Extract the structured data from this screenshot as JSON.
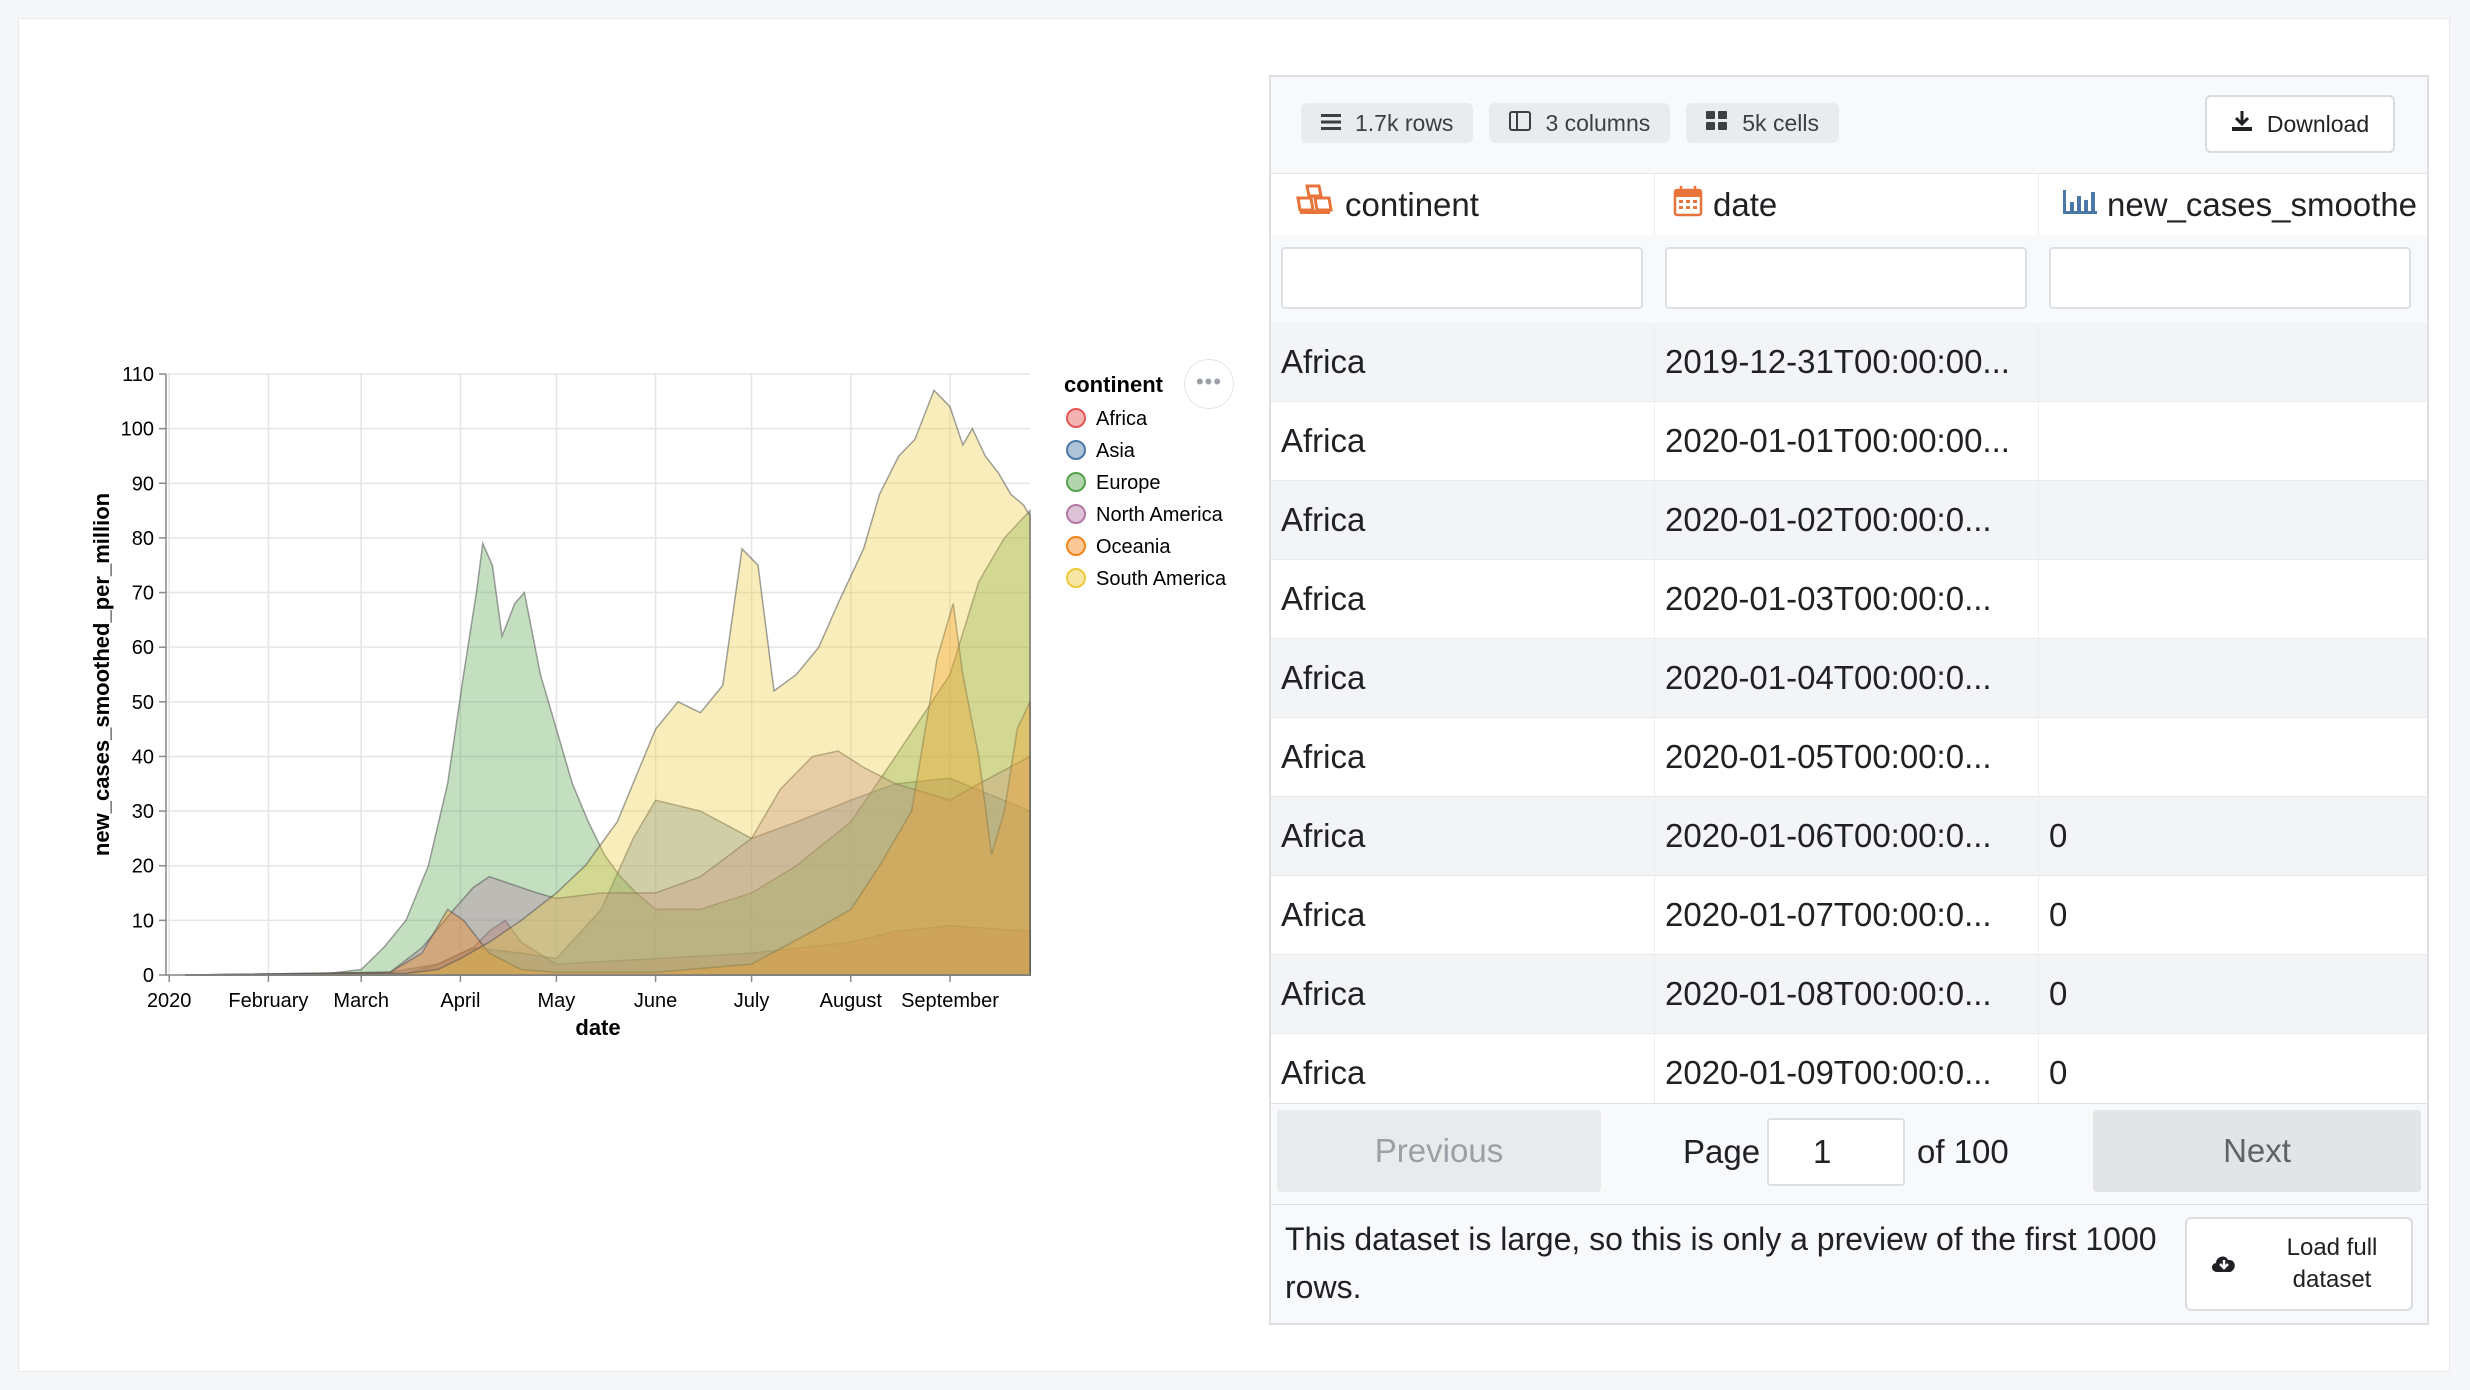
{
  "chart_data": {
    "type": "area",
    "xlabel": "date",
    "ylabel": "new_cases_smoothed_per_million",
    "ylim": [
      0,
      110
    ],
    "yticks": [
      0,
      10,
      20,
      30,
      40,
      50,
      60,
      70,
      80,
      90,
      100,
      110
    ],
    "xticks": [
      "2020",
      "February",
      "March",
      "April",
      "May",
      "June",
      "July",
      "August",
      "September"
    ],
    "xtick_dates": [
      "2020-01-01",
      "2020-02-01",
      "2020-03-01",
      "2020-04-01",
      "2020-05-01",
      "2020-06-01",
      "2020-07-01",
      "2020-08-01",
      "2020-09-01"
    ],
    "xlim": [
      "2019-12-31",
      "2020-09-26"
    ],
    "grid": true,
    "stacked": false,
    "legend_title": "continent",
    "legend_position": "right",
    "series": [
      {
        "name": "Africa",
        "color": "#e45756",
        "points": [
          [
            "2020-01-06",
            0
          ],
          [
            "2020-03-15",
            0.3
          ],
          [
            "2020-03-25",
            2
          ],
          [
            "2020-04-05",
            5
          ],
          [
            "2020-04-10",
            8
          ],
          [
            "2020-04-15",
            10
          ],
          [
            "2020-04-20",
            6
          ],
          [
            "2020-05-01",
            2
          ],
          [
            "2020-06-01",
            3
          ],
          [
            "2020-07-01",
            4
          ],
          [
            "2020-08-01",
            6
          ],
          [
            "2020-08-15",
            8
          ],
          [
            "2020-09-01",
            9
          ],
          [
            "2020-09-26",
            8
          ]
        ]
      },
      {
        "name": "Asia",
        "color": "#4c78a8",
        "points": [
          [
            "2020-01-06",
            0
          ],
          [
            "2020-02-15",
            0.2
          ],
          [
            "2020-03-10",
            0.5
          ],
          [
            "2020-03-25",
            2
          ],
          [
            "2020-04-05",
            5
          ],
          [
            "2020-04-20",
            4
          ],
          [
            "2020-05-01",
            3
          ],
          [
            "2020-05-15",
            12
          ],
          [
            "2020-05-25",
            25
          ],
          [
            "2020-06-01",
            32
          ],
          [
            "2020-06-15",
            30
          ],
          [
            "2020-07-01",
            25
          ],
          [
            "2020-07-15",
            28
          ],
          [
            "2020-08-01",
            32
          ],
          [
            "2020-08-15",
            35
          ],
          [
            "2020-09-01",
            36
          ],
          [
            "2020-09-26",
            30
          ]
        ]
      },
      {
        "name": "Europe",
        "color": "#54a24b",
        "points": [
          [
            "2020-01-06",
            0
          ],
          [
            "2020-02-20",
            0.3
          ],
          [
            "2020-03-01",
            1
          ],
          [
            "2020-03-08",
            5
          ],
          [
            "2020-03-15",
            10
          ],
          [
            "2020-03-22",
            20
          ],
          [
            "2020-03-28",
            35
          ],
          [
            "2020-04-02",
            55
          ],
          [
            "2020-04-06",
            70
          ],
          [
            "2020-04-08",
            79
          ],
          [
            "2020-04-11",
            75
          ],
          [
            "2020-04-14",
            62
          ],
          [
            "2020-04-18",
            68
          ],
          [
            "2020-04-21",
            70
          ],
          [
            "2020-04-26",
            55
          ],
          [
            "2020-05-01",
            45
          ],
          [
            "2020-05-06",
            35
          ],
          [
            "2020-05-11",
            28
          ],
          [
            "2020-05-16",
            22
          ],
          [
            "2020-05-21",
            18
          ],
          [
            "2020-05-26",
            15
          ],
          [
            "2020-06-01",
            12
          ],
          [
            "2020-06-15",
            12
          ],
          [
            "2020-07-01",
            15
          ],
          [
            "2020-07-15",
            20
          ],
          [
            "2020-08-01",
            28
          ],
          [
            "2020-08-15",
            40
          ],
          [
            "2020-09-01",
            55
          ],
          [
            "2020-09-10",
            72
          ],
          [
            "2020-09-18",
            80
          ],
          [
            "2020-09-26",
            85
          ]
        ]
      },
      {
        "name": "North America",
        "color": "#b279a2",
        "points": [
          [
            "2020-01-06",
            0
          ],
          [
            "2020-03-10",
            0.5
          ],
          [
            "2020-03-20",
            5
          ],
          [
            "2020-03-30",
            12
          ],
          [
            "2020-04-05",
            16
          ],
          [
            "2020-04-10",
            18
          ],
          [
            "2020-04-15",
            17
          ],
          [
            "2020-04-20",
            16
          ],
          [
            "2020-04-25",
            15
          ],
          [
            "2020-05-01",
            14
          ],
          [
            "2020-05-15",
            15
          ],
          [
            "2020-06-01",
            15
          ],
          [
            "2020-06-15",
            18
          ],
          [
            "2020-07-01",
            25
          ],
          [
            "2020-07-10",
            34
          ],
          [
            "2020-07-20",
            40
          ],
          [
            "2020-07-28",
            41
          ],
          [
            "2020-08-05",
            38
          ],
          [
            "2020-08-15",
            35
          ],
          [
            "2020-09-01",
            32
          ],
          [
            "2020-09-10",
            35
          ],
          [
            "2020-09-26",
            40
          ]
        ]
      },
      {
        "name": "Oceania",
        "color": "#f58518",
        "points": [
          [
            "2020-01-06",
            0
          ],
          [
            "2020-03-10",
            0.5
          ],
          [
            "2020-03-20",
            4
          ],
          [
            "2020-03-28",
            12
          ],
          [
            "2020-04-02",
            10
          ],
          [
            "2020-04-10",
            4
          ],
          [
            "2020-04-20",
            1
          ],
          [
            "2020-05-01",
            0.5
          ],
          [
            "2020-06-01",
            0.5
          ],
          [
            "2020-07-01",
            2
          ],
          [
            "2020-07-20",
            8
          ],
          [
            "2020-08-01",
            12
          ],
          [
            "2020-08-10",
            20
          ],
          [
            "2020-08-20",
            30
          ],
          [
            "2020-08-28",
            58
          ],
          [
            "2020-09-02",
            68
          ],
          [
            "2020-09-05",
            55
          ],
          [
            "2020-09-10",
            40
          ],
          [
            "2020-09-14",
            22
          ],
          [
            "2020-09-18",
            30
          ],
          [
            "2020-09-22",
            45
          ],
          [
            "2020-09-26",
            50
          ]
        ]
      },
      {
        "name": "South America",
        "color": "#eeca3b",
        "points": [
          [
            "2020-01-06",
            0
          ],
          [
            "2020-03-15",
            0.3
          ],
          [
            "2020-03-25",
            1
          ],
          [
            "2020-04-01",
            3
          ],
          [
            "2020-04-10",
            6
          ],
          [
            "2020-04-20",
            10
          ],
          [
            "2020-05-01",
            15
          ],
          [
            "2020-05-10",
            20
          ],
          [
            "2020-05-20",
            28
          ],
          [
            "2020-06-01",
            45
          ],
          [
            "2020-06-08",
            50
          ],
          [
            "2020-06-15",
            48
          ],
          [
            "2020-06-22",
            53
          ],
          [
            "2020-06-28",
            78
          ],
          [
            "2020-07-03",
            75
          ],
          [
            "2020-07-08",
            52
          ],
          [
            "2020-07-15",
            55
          ],
          [
            "2020-07-22",
            60
          ],
          [
            "2020-07-28",
            68
          ],
          [
            "2020-08-05",
            78
          ],
          [
            "2020-08-10",
            88
          ],
          [
            "2020-08-16",
            95
          ],
          [
            "2020-08-21",
            98
          ],
          [
            "2020-08-27",
            107
          ],
          [
            "2020-09-01",
            104
          ],
          [
            "2020-09-05",
            97
          ],
          [
            "2020-09-08",
            100
          ],
          [
            "2020-09-12",
            95
          ],
          [
            "2020-09-16",
            92
          ],
          [
            "2020-09-20",
            88
          ],
          [
            "2020-09-24",
            86
          ],
          [
            "2020-09-26",
            84
          ]
        ]
      }
    ]
  },
  "chips": [
    {
      "icon": "rows-icon",
      "label": "1.7k rows"
    },
    {
      "icon": "columns-icon",
      "label": "3 columns"
    },
    {
      "icon": "cells-icon",
      "label": "5k cells"
    }
  ],
  "download_label": "Download",
  "columns": [
    {
      "icon": "category-icon",
      "label": "continent"
    },
    {
      "icon": "calendar-icon",
      "label": "date"
    },
    {
      "icon": "bar-chart-icon",
      "label": "new_cases_smoothe"
    }
  ],
  "rows": [
    [
      "Africa",
      "2019-12-31T00:00:00...",
      ""
    ],
    [
      "Africa",
      "2020-01-01T00:00:00...",
      ""
    ],
    [
      "Africa",
      "2020-01-02T00:00:0...",
      ""
    ],
    [
      "Africa",
      "2020-01-03T00:00:0...",
      ""
    ],
    [
      "Africa",
      "2020-01-04T00:00:0...",
      ""
    ],
    [
      "Africa",
      "2020-01-05T00:00:0...",
      ""
    ],
    [
      "Africa",
      "2020-01-06T00:00:0...",
      "0"
    ],
    [
      "Africa",
      "2020-01-07T00:00:0...",
      "0"
    ],
    [
      "Africa",
      "2020-01-08T00:00:0...",
      "0"
    ],
    [
      "Africa",
      "2020-01-09T00:00:0...",
      "0"
    ]
  ],
  "pager": {
    "previous": "Previous",
    "page_label": "Page",
    "page_value": "1",
    "of_label": "of 100",
    "next": "Next"
  },
  "notice": "This dataset is large, so this is only a preview of the first 1000 rows.",
  "load_full": "Load full dataset",
  "more_menu": "•••"
}
